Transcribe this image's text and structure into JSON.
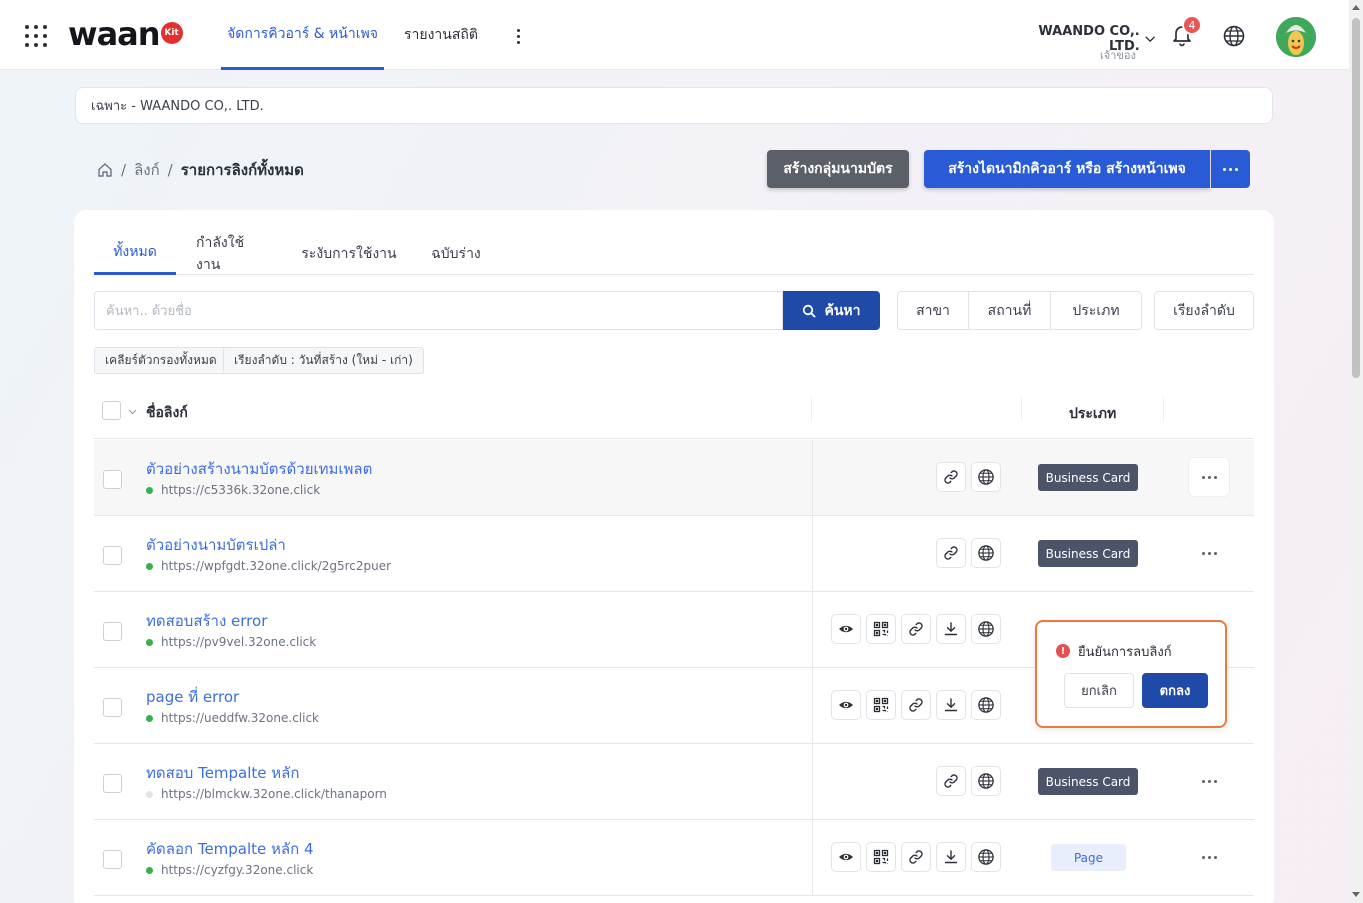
{
  "header": {
    "logo_text": "waan",
    "logo_badge": "Kit",
    "nav_tabs": [
      {
        "label": "จัดการคิวอาร์ & หน้าเพจ",
        "active": true
      },
      {
        "label": "รายงานสถิติ",
        "active": false
      }
    ],
    "org_name": "WAANDO CO,. LTD.",
    "org_role": "เจ้าของ",
    "notification_count": "4",
    "icons": [
      "apps-grid-icon",
      "more-vertical-icon",
      "chevron-down-icon",
      "bell-icon",
      "globe-icon"
    ]
  },
  "scope": {
    "label": "เฉพาะ - WAANDO CO,. LTD."
  },
  "breadcrumb": {
    "home_icon": "home-icon",
    "link": "ลิงก์",
    "current": "รายการลิงก์ทั้งหมด",
    "separator": "/"
  },
  "actions": {
    "create_group_label": "สร้างกลุ่มนามบัตร",
    "create_label": "สร้างไดนามิกคิวอาร์ หรือ สร้างหน้าเพจ"
  },
  "tabs": [
    {
      "label": "ทั้งหมด",
      "active": true
    },
    {
      "label": "กำลังใช้งาน",
      "active": false
    },
    {
      "label": "ระงับการใช้งาน",
      "active": false
    },
    {
      "label": "ฉบับร่าง",
      "active": false
    }
  ],
  "search": {
    "placeholder": "ค้นหา.. ด้วยชื่อ",
    "button_label": "ค้นหา"
  },
  "filters": [
    {
      "label": "สาขา"
    },
    {
      "label": "สถานที่"
    },
    {
      "label": "ประเภท"
    }
  ],
  "sort": {
    "label": "เรียงลำดับ"
  },
  "chips": [
    {
      "label": "เคลียร์ตัวกรองทั้งหมด"
    },
    {
      "label": "เรียงลำดับ : วันที่สร้าง (ใหม่ - เก่า)"
    }
  ],
  "table": {
    "col_name": "ชื่อลิงก์",
    "col_type": "ประเภท",
    "rows": [
      {
        "title": "ตัวอย่างสร้างนามบัตรด้วยเทมเพลต",
        "url": "https://c5336k.32one.click",
        "active": true,
        "actions": [
          "link-icon",
          "globe-icon"
        ],
        "type": "Business Card"
      },
      {
        "title": "ตัวอย่างนามบัตรเปล่า",
        "url": "https://wpfgdt.32one.click/2g5rc2puer",
        "active": true,
        "actions": [
          "link-icon",
          "globe-icon"
        ],
        "type": "Business Card"
      },
      {
        "title": "ทดสอบสร้าง error",
        "url": "https://pv9vel.32one.click",
        "active": true,
        "actions": [
          "eye-icon",
          "qr-code-icon",
          "link-icon",
          "download-icon",
          "globe-icon"
        ],
        "type": ""
      },
      {
        "title": "page ที่ error",
        "url": "https://ueddfw.32one.click",
        "active": true,
        "actions": [
          "eye-icon",
          "qr-code-icon",
          "link-icon",
          "download-icon",
          "globe-icon"
        ],
        "type": ""
      },
      {
        "title": "ทดสอบ Tempalte หลัก",
        "url": "https://blmckw.32one.click/thanaporn",
        "active": false,
        "actions": [
          "link-icon",
          "globe-icon"
        ],
        "type": "Business Card"
      },
      {
        "title": "คัดลอก Tempalte หลัก 4",
        "url": "https://cyzfgy.32one.click",
        "active": true,
        "actions": [
          "eye-icon",
          "qr-code-icon",
          "link-icon",
          "download-icon",
          "globe-icon"
        ],
        "type": "Page"
      }
    ]
  },
  "popconfirm": {
    "message": "ยืนยันการลบลิงก์",
    "cancel_label": "ยกเลิก",
    "ok_label": "ตกลง"
  },
  "colors": {
    "primary": "#2a5bd7",
    "dark_primary": "#1f4aa8",
    "badge_card": "#4b5469",
    "badge_page_bg": "#e8eefc",
    "popover_border": "#ea7b3a",
    "status_active": "#2fb34a"
  }
}
